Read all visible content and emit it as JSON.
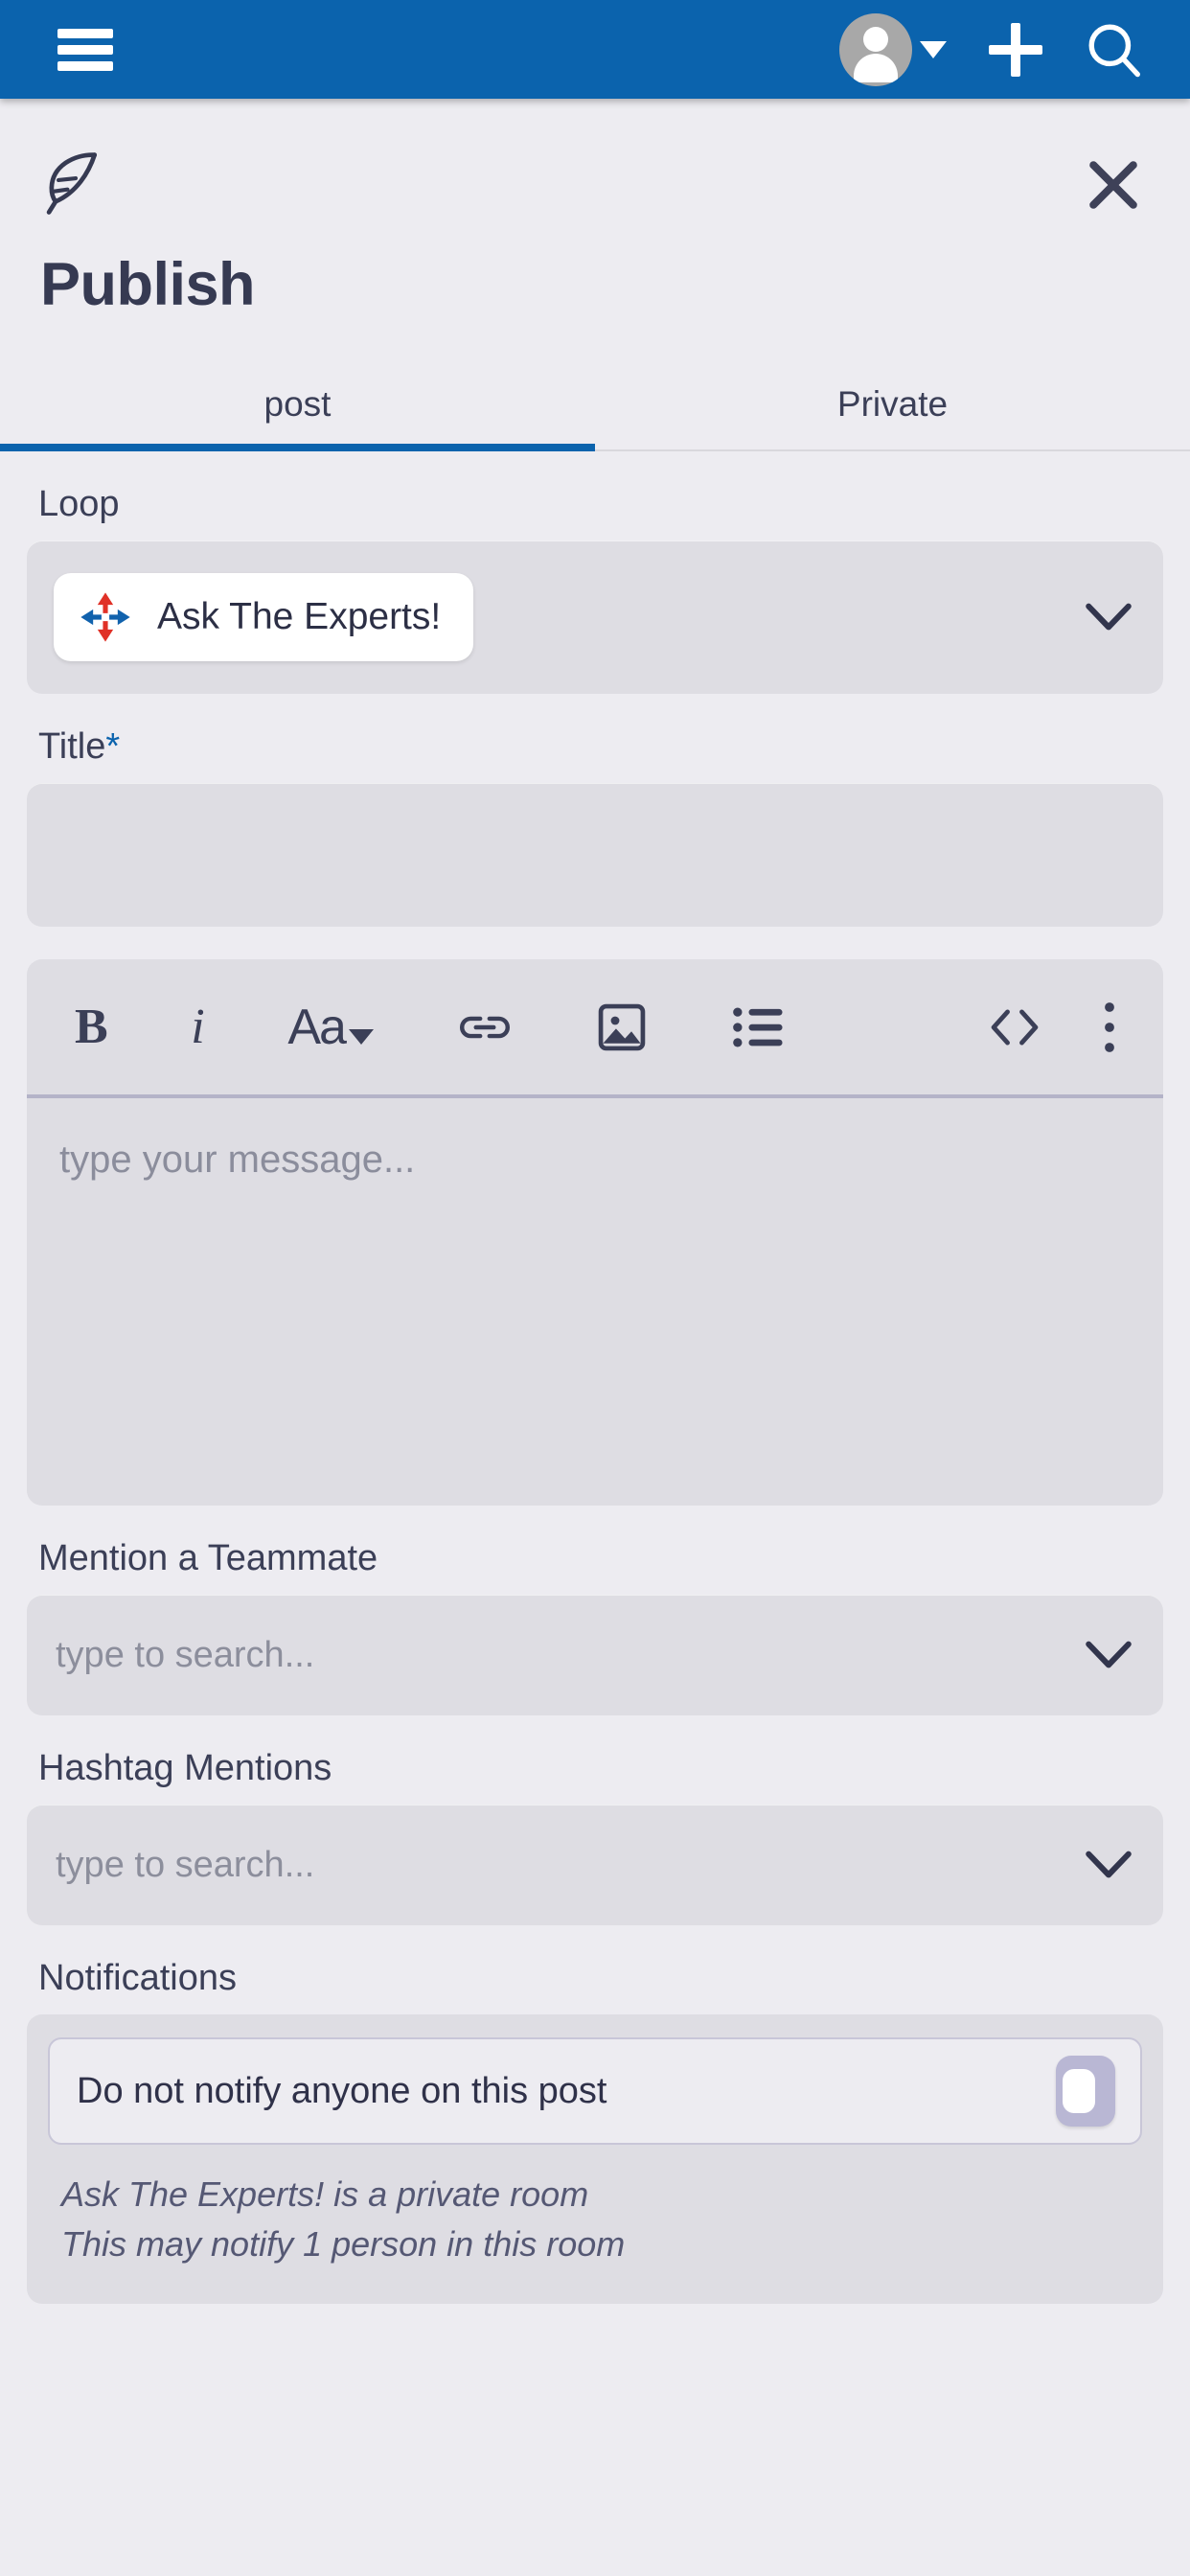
{
  "appbar": {
    "menu_icon": "hamburger-icon",
    "avatar_icon": "user-avatar",
    "avatar_caret_icon": "caret-down-icon",
    "add_icon": "plus-icon",
    "search_icon": "search-icon",
    "background_color": "#0b63ad"
  },
  "sheet": {
    "brand_icon": "feather-icon",
    "close_icon": "close-icon",
    "title": "Publish",
    "accent_color": "#0b63ad",
    "text_color": "#363a52"
  },
  "tabs": [
    {
      "label": "post",
      "active": true
    },
    {
      "label": "Private",
      "active": false
    }
  ],
  "loop": {
    "label": "Loop",
    "selected": "Ask The Experts!",
    "logo_icon": "ask-the-experts-logo",
    "chevron_icon": "chevron-down-icon"
  },
  "title_field": {
    "label": "Title",
    "required_marker": "*",
    "value": "",
    "placeholder": ""
  },
  "editor": {
    "toolbar": [
      {
        "name": "bold-button",
        "glyph": "B"
      },
      {
        "name": "italic-button",
        "glyph": "i"
      },
      {
        "name": "font-size-button",
        "glyph": "Aa"
      },
      {
        "name": "link-button",
        "glyph": "link-icon"
      },
      {
        "name": "image-button",
        "glyph": "image-icon"
      },
      {
        "name": "bullet-list-button",
        "glyph": "list-icon"
      },
      {
        "name": "code-button",
        "glyph": "<>"
      },
      {
        "name": "more-options-button",
        "glyph": "kebab-icon"
      }
    ],
    "message_value": "",
    "message_placeholder": "type your message..."
  },
  "mention": {
    "label": "Mention a Teammate",
    "placeholder": "type to search...",
    "value": "",
    "chevron_icon": "chevron-down-icon"
  },
  "hashtag": {
    "label": "Hashtag Mentions",
    "placeholder": "type to search...",
    "value": "",
    "chevron_icon": "chevron-down-icon"
  },
  "notifications": {
    "label": "Notifications",
    "option_label": "Do not notify anyone on this post",
    "toggle_state": "off",
    "notes": [
      "Ask The Experts! is a private room",
      "This may notify 1 person in this room"
    ]
  }
}
